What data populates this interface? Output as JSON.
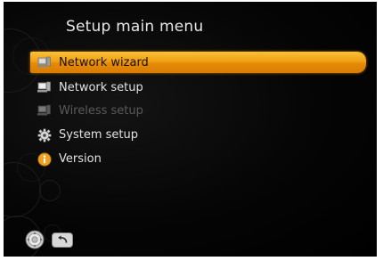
{
  "menu": {
    "title": "Setup main menu",
    "items": [
      {
        "label": "Network wizard",
        "icon": "network-computer-icon",
        "state": "selected"
      },
      {
        "label": "Network setup",
        "icon": "network-computer-icon",
        "state": "normal"
      },
      {
        "label": "Wireless setup",
        "icon": "network-computer-icon",
        "state": "disabled"
      },
      {
        "label": "System setup",
        "icon": "gear-icon",
        "state": "normal"
      },
      {
        "label": "Version",
        "icon": "info-icon",
        "state": "normal"
      }
    ]
  },
  "footer": {
    "icons": [
      "navigation-pad-icon",
      "back-icon"
    ]
  },
  "colors": {
    "highlight": "#f2a014",
    "background": "#000000",
    "text": "#e2e2e2",
    "disabled_text": "#5a5a5a",
    "info_icon": "#f0a020"
  }
}
